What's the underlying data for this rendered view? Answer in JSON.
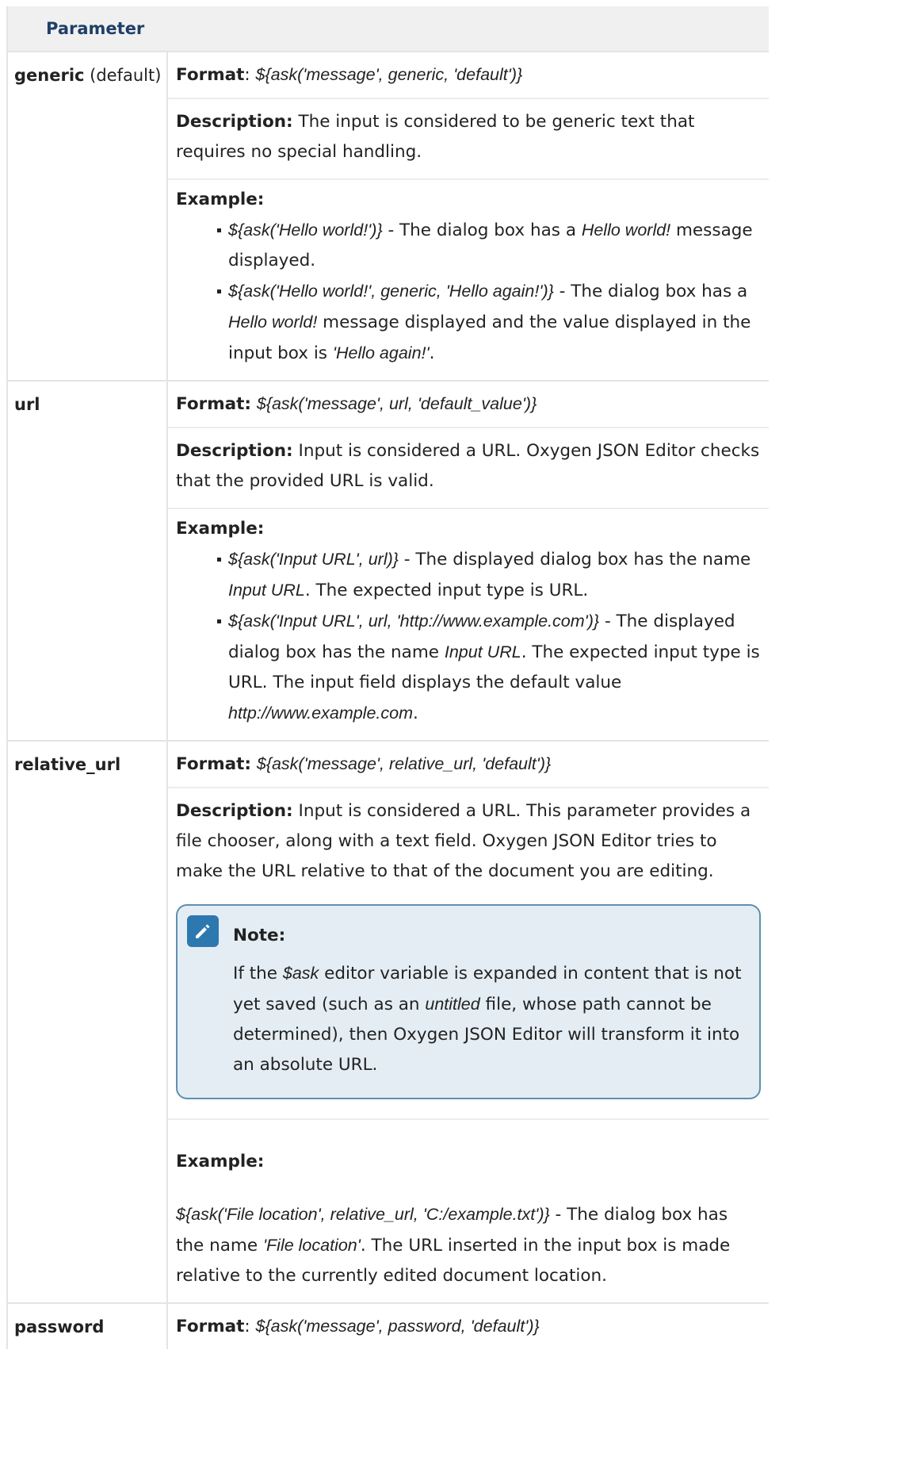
{
  "table": {
    "header": "Parameter",
    "rows": [
      {
        "name": "generic",
        "name_suffix": " (default)",
        "format_label": "Format",
        "format_sep": ": ",
        "format_value": "${ask('message', generic, 'default')}",
        "description_label": "Description:",
        "description": " The input is considered to be generic text that requires no special handling.",
        "example_label": "Example:",
        "examples": [
          {
            "parts": [
              {
                "t": "${ask('Hello world!')}",
                "i": true
              },
              {
                "t": " - The dialog box has a ",
                "i": false
              },
              {
                "t": "Hello world!",
                "i": true
              },
              {
                "t": " message displayed.",
                "i": false
              }
            ]
          },
          {
            "parts": [
              {
                "t": "${ask('Hello world!', generic, 'Hello again!')}",
                "i": true
              },
              {
                "t": " - The dialog box has a ",
                "i": false
              },
              {
                "t": "Hello world!",
                "i": true
              },
              {
                "t": " message displayed and the value displayed in the input box is ",
                "i": false
              },
              {
                "t": "'Hello again!'",
                "i": true
              },
              {
                "t": ".",
                "i": false
              }
            ]
          }
        ]
      },
      {
        "name": "url",
        "format_label": "Format:",
        "format_sep": " ",
        "format_value": "${ask('message', url, 'default_value')}",
        "description_label": "Description:",
        "description": " Input is considered a URL. Oxygen JSON Editor checks that the provided URL is valid.",
        "example_label": "Example:",
        "examples": [
          {
            "parts": [
              {
                "t": "${ask('Input URL', url)}",
                "i": true
              },
              {
                "t": " - The displayed dialog box has the name ",
                "i": false
              },
              {
                "t": "In­put URL",
                "i": true
              },
              {
                "t": ". The expected input type is URL.",
                "i": false
              }
            ]
          },
          {
            "parts": [
              {
                "t": "${ask('Input URL', url, 'http://www.example.com')}",
                "i": true
              },
              {
                "t": " - The displayed dialog box has the name ",
                "i": false
              },
              {
                "t": "Input URL",
                "i": true
              },
              {
                "t": ". The expected input type is URL. The input field displays the default value ",
                "i": false
              },
              {
                "t": "http://www.example­.com",
                "i": true
              },
              {
                "t": ".",
                "i": false
              }
            ]
          }
        ]
      },
      {
        "name": "relative_url",
        "format_label": "Format:",
        "format_sep": " ",
        "format_value": "${ask('message', relative_url, 'default')}",
        "description_label": "Description:",
        "description": " Input is considered a URL. This parameter provides a file chooser, along with a text field. Oxygen JSON Editor tries to make the URL relative to that of the document you are editing.",
        "note": {
          "title": "Note:",
          "icon": "pencil-note-icon",
          "parts": [
            {
              "t": "If the ",
              "i": false
            },
            {
              "t": "$ask",
              "i": true
            },
            {
              "t": " editor variable is expanded in content that is not yet saved (such as an ",
              "i": false
            },
            {
              "t": "untitled",
              "i": true
            },
            {
              "t": " file, whose path cannot be determined), then Oxygen JSON Editor will transform it into an absolute URL.",
              "i": false
            }
          ]
        },
        "example_label": "Example:",
        "example_parts": [
          {
            "t": "${ask('File location', relative_url, 'C:/example.txt')}",
            "i": true
          },
          {
            "t": " - The dialog box has the name ",
            "i": false
          },
          {
            "t": "'File location'",
            "i": true
          },
          {
            "t": ". The URL inserted in the input box is made relative to the currently edited document location.",
            "i": false
          }
        ]
      },
      {
        "name": "password",
        "format_label": "Format",
        "format_sep": ": ",
        "format_value": "${ask('message', password, 'default')}"
      }
    ]
  },
  "colors": {
    "header_bg": "#f0f0f0",
    "header_text": "#1f3f66",
    "border": "#e4e4e4",
    "note_bg": "#e4edf3",
    "note_border": "#5f8fb0",
    "note_icon": "#2e78b0"
  }
}
